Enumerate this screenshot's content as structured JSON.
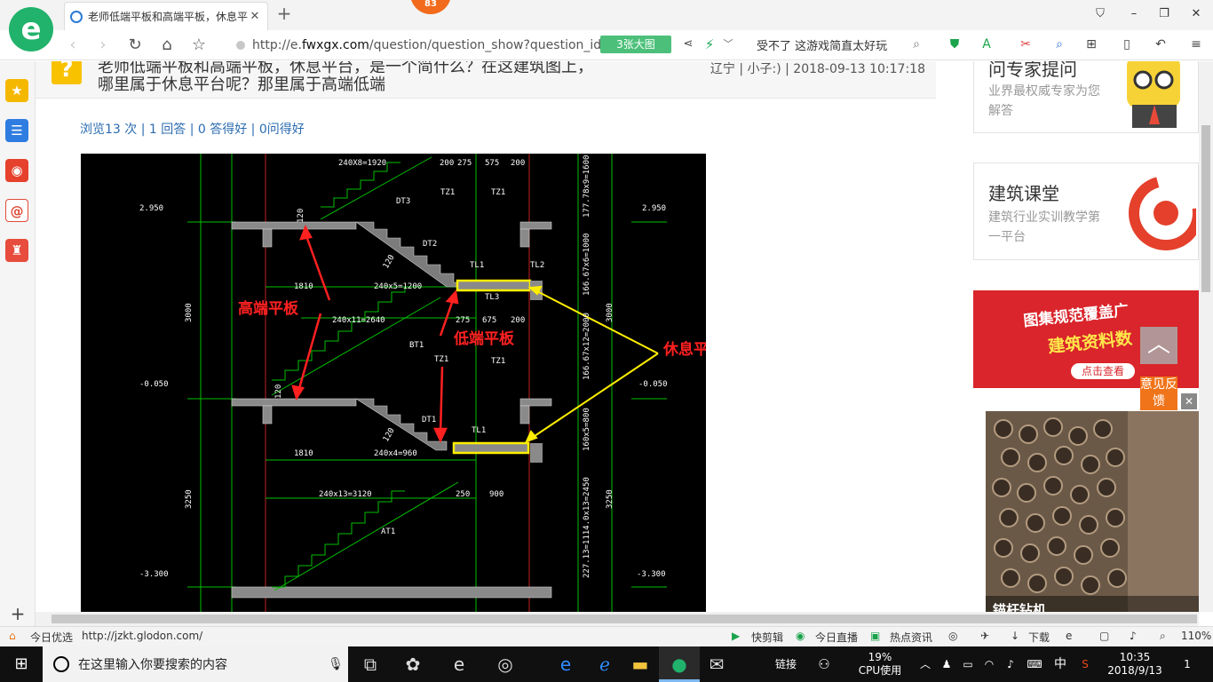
{
  "tab": {
    "title": "老师低端平板和高端平板，休息平",
    "close": "✕"
  },
  "notify": {
    "count": "83"
  },
  "window": {
    "min": "–",
    "max": "❐",
    "close": "✕",
    "skin": "⛉"
  },
  "toolbar": {
    "url_prefix": "http://e.",
    "url_domain": "fwxgx.com",
    "url_path": "/question/question_show?question_id",
    "image_button": "3张大图",
    "search_text": "受不了 这游戏简直太好玩"
  },
  "question": {
    "mark": "?",
    "title_line1": "老师低端平板和高端平板，休息平台，是一个简什么？在这建筑图上，",
    "title_line2": "哪里属于休息平台呢？那里属于高端低端",
    "meta": "辽宁 | 小子:) | 2018-09-13 10:17:18",
    "stats": "浏览13 次 | 1 回答 | 0 答得好 | 0问得好"
  },
  "drawing": {
    "labels": {
      "high_slab": "高端平板",
      "low_slab": "低端平板",
      "rest_platform": "休息平台"
    },
    "elev": {
      "top": "2.950",
      "mid": "-0.050",
      "bot": "-3.300"
    },
    "dims": {
      "d1": "240X8=1920",
      "d2": "200",
      "d3": "275",
      "d4": "575",
      "d5": "200",
      "d6": "1810",
      "d7": "240x5=1200",
      "d8": "240x11=2640",
      "d9": "275",
      "d10": "675",
      "d11": "200",
      "d12": "1810",
      "d13": "240x4=960",
      "d14": "240x13=3120",
      "d15": "250",
      "d16": "900",
      "h1": "3000",
      "h2": "3000",
      "h3": "3250",
      "h4": "3250",
      "v1": "177.78x9=1600",
      "v2": "166.67x6=1000",
      "v3": "166.67x12=2000",
      "v4": "160x5=800",
      "v5": "227.13=1114.0x13=2450",
      "t1": "120",
      "t2": "120",
      "t3": "120",
      "t4": "120"
    },
    "tags": {
      "dt3": "DT3",
      "tz1a": "TZ1",
      "tz1b": "TZ1",
      "dt2": "DT2",
      "tl1": "TL1",
      "tl2": "TL2",
      "tl3": "TL3",
      "bt1": "BT1",
      "tz1c": "TZ1",
      "tz1d": "TZ1",
      "dt1": "DT1",
      "tl1b": "TL1",
      "at1": "AT1"
    }
  },
  "right": {
    "expert_title": "问专家提问",
    "expert_sub": "业界最权威专家为您解答",
    "course_title": "建筑课堂",
    "course_sub": "建筑行业实训教学第一平台",
    "banner_line1": "图集规范覆盖广",
    "banner_line2": "建筑资料数",
    "banner_btn": "点击查看",
    "photo_caption": "锚杆钻机",
    "ad_tag": "广告",
    "back_top": "︿",
    "feedback": "意见反馈",
    "close": "✕"
  },
  "statusbar": {
    "left_label": "今日优选",
    "url": "http://jzkt.glodon.com/",
    "video": "快剪辑",
    "live": "今日直播",
    "news": "热点资讯",
    "download": "下载",
    "zoom": "110%"
  },
  "taskbar": {
    "search_placeholder": "在这里输入你要搜索的内容",
    "link": "链接",
    "cpu_pct": "19%",
    "cpu_label": "CPU使用",
    "ime": "中",
    "time": "10:35",
    "date": "2018/9/13",
    "notif": "1"
  },
  "colors": {
    "accent_green": "#21b26b",
    "cad_bg": "#000000",
    "cad_green": "#00d400",
    "cad_red": "#ff2020",
    "cad_yellow": "#ffee00"
  }
}
